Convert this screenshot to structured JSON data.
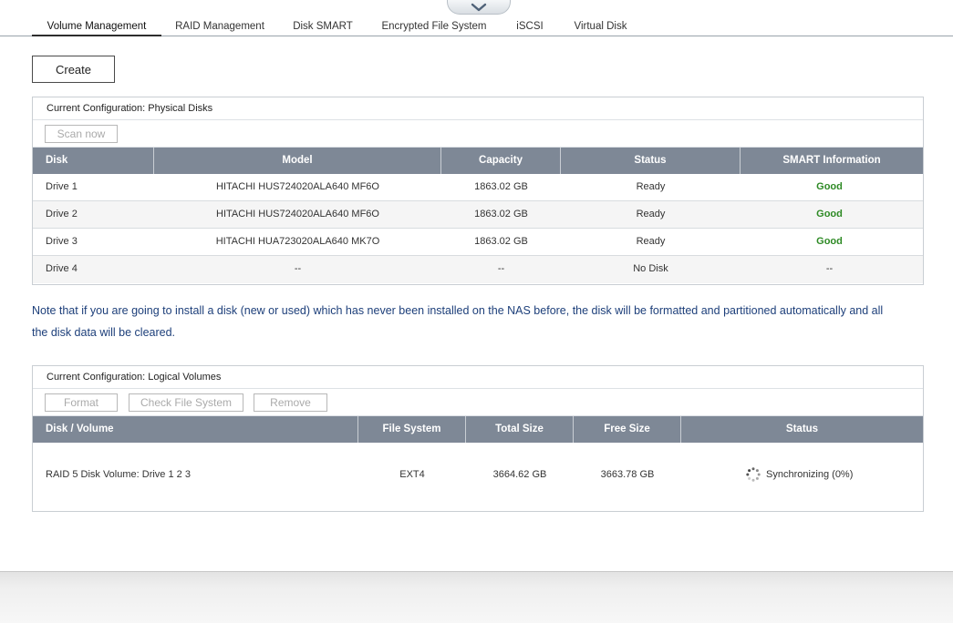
{
  "tabs": [
    "Volume Management",
    "RAID Management",
    "Disk SMART",
    "Encrypted File System",
    "iSCSI",
    "Virtual Disk"
  ],
  "active_tab": "Volume Management",
  "create_label": "Create",
  "physical": {
    "title": "Current Configuration: Physical Disks",
    "scan_label": "Scan now",
    "columns": [
      "Disk",
      "Model",
      "Capacity",
      "Status",
      "SMART Information"
    ],
    "rows": [
      [
        "Drive 1",
        "HITACHI HUS724020ALA640 MF6O",
        "1863.02 GB",
        "Ready",
        "Good"
      ],
      [
        "Drive 2",
        "HITACHI HUS724020ALA640 MF6O",
        "1863.02 GB",
        "Ready",
        "Good"
      ],
      [
        "Drive 3",
        "HITACHI HUA723020ALA640 MK7O",
        "1863.02 GB",
        "Ready",
        "Good"
      ],
      [
        "Drive 4",
        "--",
        "--",
        "No Disk",
        "--"
      ]
    ]
  },
  "note": "Note that if you are going to install a disk (new or used) which has never been installed on the NAS before, the disk will be formatted and partitioned automatically and all the disk data will be cleared.",
  "logical": {
    "title": "Current Configuration: Logical Volumes",
    "format_label": "Format",
    "check_label": "Check File System",
    "remove_label": "Remove",
    "columns": [
      "Disk / Volume",
      "File System",
      "Total Size",
      "Free Size",
      "Status"
    ],
    "rows": [
      [
        "RAID 5 Disk Volume: Drive 1 2 3",
        "EXT4",
        "3664.62 GB",
        "3663.78 GB",
        "Synchronizing (0%)"
      ]
    ]
  },
  "colors": {
    "header_bg": "#7e8896",
    "good": "#2e8a25",
    "note": "#1d3f7a"
  },
  "icons": {
    "collapse": "chevron-down-icon",
    "status": "spinner-icon"
  }
}
